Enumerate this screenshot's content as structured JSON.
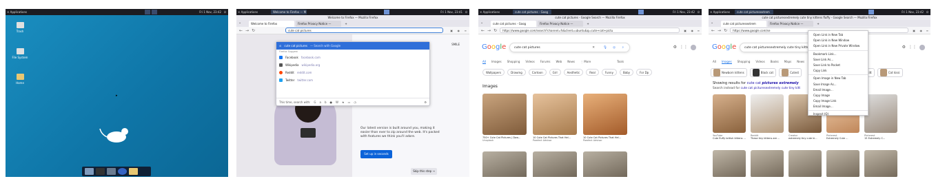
{
  "clock": "Fri 1 Nov, 23:42",
  "clock2": "Fri 1 Nov, 23:41",
  "applications_label": "Applications",
  "panel1": {
    "desktop_icons": [
      {
        "label": "Trash"
      },
      {
        "label": "File System"
      },
      {
        "label": "Home"
      }
    ]
  },
  "panel2": {
    "taskbar_title": "Welcome to Firefox — M",
    "window_title": "Welcome to Firefox — Mozilla Firefox",
    "tabs": [
      "Welcome to Firefox",
      "Firefox Privacy Notice —"
    ],
    "url": "cute cat pictures",
    "suggestion_selected": {
      "text": "cute cat pictures",
      "suffix": "— Search with Google"
    },
    "suggest_header": "Firefox Suggest",
    "suggestions": [
      {
        "name": "Facebook",
        "url": "facebook.com",
        "color": "#1877f2"
      },
      {
        "name": "Wikipedia",
        "url": "wikipedia.org",
        "color": "#555555"
      },
      {
        "name": "Reddit",
        "url": "reddit.com",
        "color": "#ff4500"
      },
      {
        "name": "Twitter",
        "url": "twitter.com",
        "color": "#1da1f2"
      }
    ],
    "footer_label": "This time, search with:",
    "welcome_text": "Our latest version is built around you, making it easier than ever to zip around the web. It's packed with features we think you'll adore.",
    "setup_button": "Set up in seconds",
    "skip_button": "Skip this step →",
    "corner_text": "SMILE"
  },
  "panel3": {
    "taskbar_title": "cute cat pictures - Goog",
    "window_title": "cute cat pictures - Google Search — Mozilla Firefox",
    "tabs": [
      "cute cat pictures - Goog",
      "Firefox Privacy Notice —"
    ],
    "url": "https://www.google.com/search?channel=fs&client=ubuntu&q=cute+cat+pictu",
    "search_query": "cute cat pictures",
    "google_logo": "Google",
    "search_tabs": [
      "All",
      "Images",
      "Shopping",
      "Videos",
      "Forums",
      "Web",
      "News",
      "⋮ More",
      "Tools"
    ],
    "chips": [
      "Wallpapers",
      "Drawing",
      "Cartoon",
      "Girl",
      "Aesthetic",
      "Real",
      "Funny",
      "Baby",
      "For Dp"
    ],
    "images_heading": "Images",
    "results": [
      {
        "caption": "750+ Cute Cat Pictures | Dow...",
        "source": "Unsplash"
      },
      {
        "caption": "10 Cute Cat Pictures That Hel...",
        "source": "Pawfect Advisor"
      },
      {
        "caption": "10 Cute Cat Pictures That Hel...",
        "source": "Pawfect Advisor"
      }
    ]
  },
  "panel4": {
    "taskbar_title": "cute cat picturesextrem",
    "window_title": "cute cat picturesextremely cute tiny kittens fluffy - Google Search — Mozilla Firefox",
    "tabs": [
      "cute cat picturesextrem",
      "Firefox Privacy Notice —"
    ],
    "url": "https://www.google.com/se",
    "search_query": "cute cat picturesextremely cute tiny kitten",
    "google_logo": "Google",
    "search_tabs": [
      "All",
      "Images",
      "Shopping",
      "Videos",
      "Books",
      "Maps",
      "News",
      "⋮ More"
    ],
    "chips": [
      "Newborn kittens",
      "Black cat",
      "Cutest",
      "Newborn kitt",
      "Cat kissi"
    ],
    "showing_label": "Showing results for",
    "showing_query_plain": "cute cat",
    "showing_query_bold": "pictures extremely",
    "search_instead_label": "Search instead for",
    "search_instead_query": "cute cat picturesextremely cute tiny kitt",
    "context_menu": [
      "Open Link in New Tab",
      "Open Link in New Window",
      "Open Link in New Private Window",
      "---",
      "Bookmark Link...",
      "Save Link As...",
      "Save Link to Pocket",
      "Copy Link",
      "---",
      "Open Image in New Tab",
      "Save Image As...",
      "Email Image...",
      "Copy Image",
      "Copy Image Link",
      "Email Image...",
      "---",
      "Inspect (Q)"
    ],
    "results": [
      {
        "source": "YouTube",
        "caption": "Cute fluffy british kittens ..."
      },
      {
        "source": "Reddit",
        "caption": "These tiny kittens are ..."
      },
      {
        "source": "Creator",
        "caption": "extremely tiny cute ki..."
      },
      {
        "source": "Pinterest",
        "caption": "Extremely Cute ..."
      },
      {
        "source": "Pinterest",
        "caption": "15 Extremely C..."
      }
    ]
  }
}
